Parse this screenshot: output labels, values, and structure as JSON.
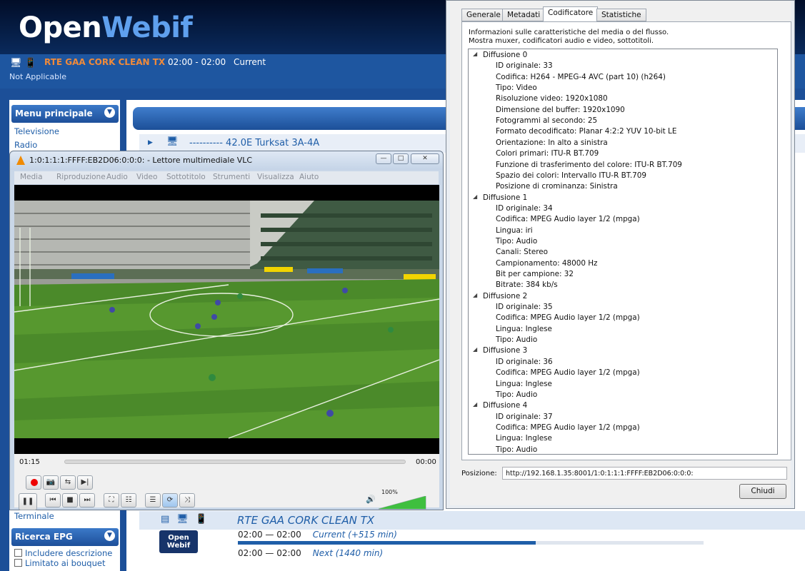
{
  "openwebif": {
    "logo_a": "Open",
    "logo_b": "Webif",
    "now_channel": "RTE GAA CORK CLEAN TX",
    "now_time": "02:00 - 02:00",
    "now_state": "Current",
    "not_applicable": "Not Applicable",
    "main_menu_title": "Menu principale",
    "menu_items": [
      "Televisione",
      "Radio"
    ],
    "satellite_row": "---------- 42.0E Turksat 3A-4A",
    "terminale": "Terminale",
    "epg_search_title": "Ricerca EPG",
    "epg_options": [
      "Includere descrizione",
      "Limitato ai bouquet"
    ],
    "channel_name": "RTE GAA CORK CLEAN TX",
    "channel_logo": "Open Webif",
    "programs": [
      {
        "time": "02:00 — 02:00",
        "label": "Current (+515 min)"
      },
      {
        "time": "02:00 — 02:00",
        "label": "Next (1440 min)"
      }
    ],
    "current_progress": 0.64
  },
  "vlc": {
    "title": "1:0:1:1:1:FFFF:EB2D06:0:0:0: - Lettore multimediale VLC",
    "menu": [
      "Media",
      "Riproduzione",
      "Audio",
      "Video",
      "Sottotitolo",
      "Strumenti",
      "Visualizza",
      "Aiuto"
    ],
    "elapsed": "01:15",
    "remaining": "00:00",
    "volume_percent": "100%",
    "volume_level": 1.0,
    "seek_progress": 0.0
  },
  "codec_dialog": {
    "tabs": [
      "Generale",
      "Metadati",
      "Codificatore",
      "Statistiche"
    ],
    "active_tab": "Codificatore",
    "description_line1": "Informazioni sulle caratteristiche del media o del flusso.",
    "description_line2": "Mostra muxer, codificatori audio e video, sottotitoli.",
    "streams": [
      {
        "name": "Diffusione 0",
        "rows": [
          "ID originale: 33",
          "Codifica: H264 - MPEG-4 AVC (part 10) (h264)",
          "Tipo: Video",
          "Risoluzione video: 1920x1080",
          "Dimensione del buffer: 1920x1090",
          "Fotogrammi al secondo: 25",
          "Formato decodificato: Planar 4:2:2 YUV 10-bit LE",
          "Orientazione: In alto a sinistra",
          "Colori primari: ITU-R BT.709",
          "Funzione di trasferimento del colore: ITU-R BT.709",
          "Spazio dei colori: Intervallo ITU-R BT.709",
          "Posizione di crominanza: Sinistra"
        ]
      },
      {
        "name": "Diffusione 1",
        "rows": [
          "ID originale: 34",
          "Codifica: MPEG Audio layer 1/2 (mpga)",
          "Lingua: iri",
          "Tipo: Audio",
          "Canali: Stereo",
          "Campionamento: 48000 Hz",
          "Bit per campione: 32",
          "Bitrate: 384 kb/s"
        ]
      },
      {
        "name": "Diffusione 2",
        "rows": [
          "ID originale: 35",
          "Codifica: MPEG Audio layer 1/2 (mpga)",
          "Lingua: Inglese",
          "Tipo: Audio"
        ]
      },
      {
        "name": "Diffusione 3",
        "rows": [
          "ID originale: 36",
          "Codifica: MPEG Audio layer 1/2 (mpga)",
          "Lingua: Inglese",
          "Tipo: Audio"
        ]
      },
      {
        "name": "Diffusione 4",
        "rows": [
          "ID originale: 37",
          "Codifica: MPEG Audio layer 1/2 (mpga)",
          "Lingua: Inglese",
          "Tipo: Audio"
        ]
      }
    ],
    "position_label": "Posizione:",
    "position_value": "http://192.168.1.35:8001/1:0:1:1:1:FFFF:EB2D06:0:0:0:",
    "close_label": "Chiudi"
  }
}
